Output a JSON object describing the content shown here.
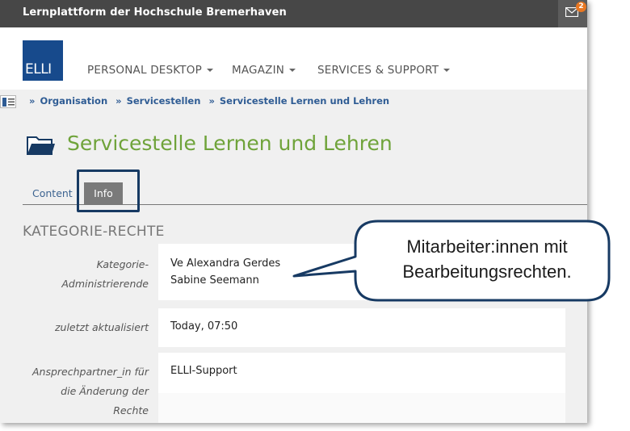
{
  "app": {
    "title": "Lernplattform der Hochschule Bremerhaven",
    "notifications_count": "2"
  },
  "logo": {
    "text": "ELLI"
  },
  "nav": [
    {
      "label": "PERSONAL DESKTOP"
    },
    {
      "label": "MAGAZIN"
    },
    {
      "label": "SERVICES & SUPPORT"
    }
  ],
  "breadcrumb": {
    "separator": "»",
    "items": [
      "Organisation",
      "Servicestellen",
      "Servicestelle Lernen und Lehren"
    ]
  },
  "page": {
    "title": "Servicestelle Lernen und Lehren"
  },
  "tabs": {
    "content": "Content",
    "info": "Info",
    "active": "Info"
  },
  "section": {
    "title": "KATEGORIE-RECHTE"
  },
  "rows": {
    "admins": {
      "label": "Kategorie-Administrierende",
      "values": [
        "Ve Alexandra Gerdes",
        "Sabine Seemann"
      ]
    },
    "updated": {
      "label": "zuletzt aktualisiert",
      "value": "Today, 07:50"
    },
    "contact": {
      "label": "Ansprechpartner_in für die Änderung der Rechte",
      "value": "ELLI-Support"
    }
  },
  "callout": {
    "line1": "Mitarbeiter:innen mit",
    "line2": "Bearbeitungsrechten."
  },
  "colors": {
    "topbar": "#474747",
    "logo": "#174a8c",
    "title_green": "#6fa33a",
    "link_blue": "#2f5c94",
    "badge": "#e87722",
    "highlight": "#173a63"
  }
}
